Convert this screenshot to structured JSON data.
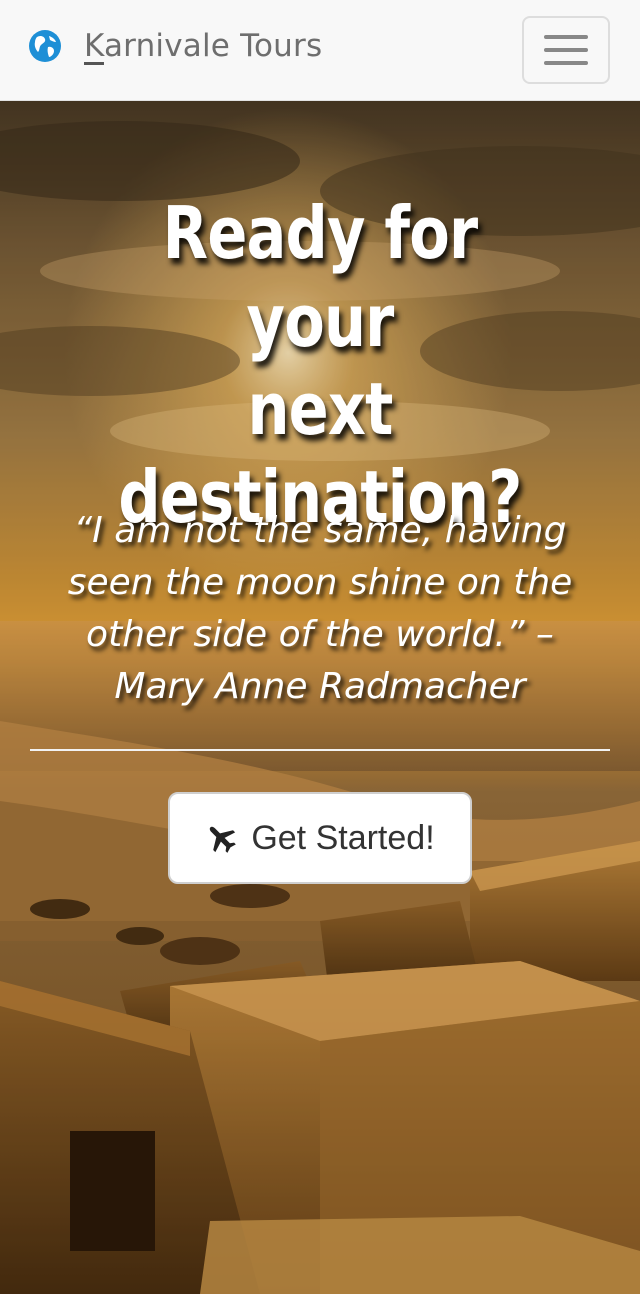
{
  "navbar": {
    "brand_icon": "globe-icon",
    "brand_initial": "K",
    "brand_rest": "arnivale Tours",
    "menu_icon": "hamburger-menu-icon"
  },
  "hero": {
    "headline_line1": "Ready for your",
    "headline_line2": "next",
    "headline_line3": "destination?",
    "quote_line1": "“I am not the same, having",
    "quote_line2": "seen the moon shine on the",
    "quote_line3": "other side of the world.” –",
    "quote_line4": "Mary Anne Radmacher",
    "cta_label": "Get Started!",
    "cta_icon": "plane-icon"
  },
  "colors": {
    "navbar_bg": "#f8f8f8",
    "brand_text": "#6e6e6e",
    "globe": "#1e8fd6",
    "hero_text": "#ffffff",
    "cta_text": "#333333"
  }
}
